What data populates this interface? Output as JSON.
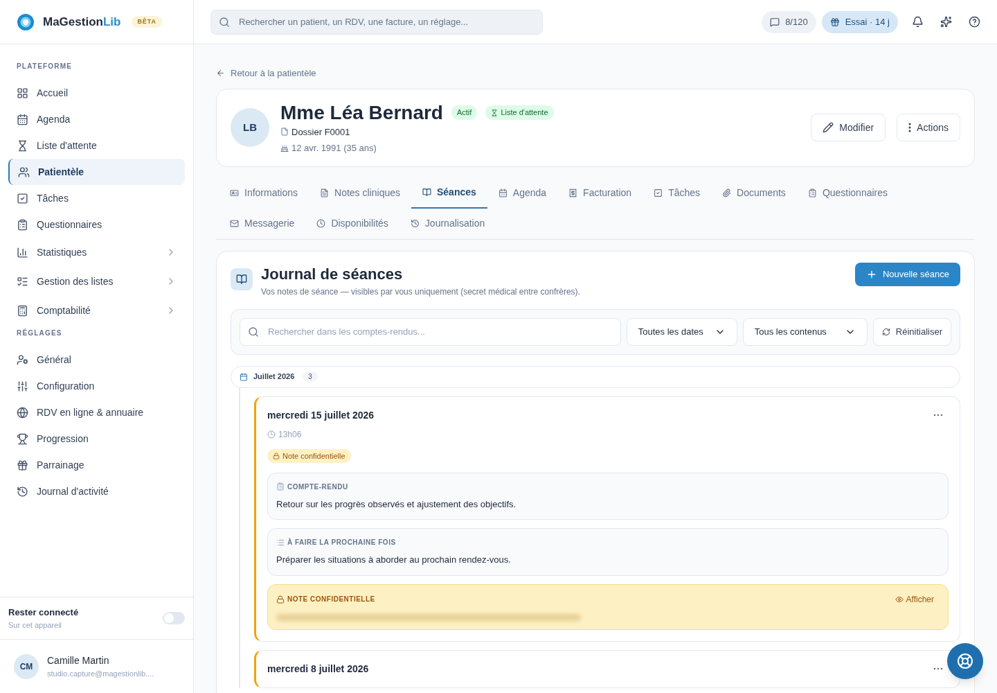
{
  "brand": {
    "name": "MaGestion",
    "name_accent": "Lib",
    "badge": "BÊTA"
  },
  "sidebar": {
    "sections": [
      {
        "title": "PLATEFORME",
        "items": [
          {
            "label": "Accueil",
            "selected": false,
            "submenu": false
          },
          {
            "label": "Agenda",
            "selected": false,
            "submenu": false
          },
          {
            "label": "Liste d'attente",
            "selected": false,
            "submenu": false
          },
          {
            "label": "Patientèle",
            "selected": true,
            "submenu": false
          },
          {
            "label": "Tâches",
            "selected": false,
            "submenu": false
          },
          {
            "label": "Questionnaires",
            "selected": false,
            "submenu": false
          },
          {
            "label": "Statistiques",
            "selected": false,
            "submenu": true
          },
          {
            "label": "Gestion des listes",
            "selected": false,
            "submenu": true
          },
          {
            "label": "Comptabilité",
            "selected": false,
            "submenu": true
          }
        ]
      },
      {
        "title": "RÉGLAGES",
        "items": [
          {
            "label": "Général",
            "selected": false,
            "submenu": false
          },
          {
            "label": "Configuration",
            "selected": false,
            "submenu": false
          },
          {
            "label": "RDV en ligne & annuaire",
            "selected": false,
            "submenu": false
          },
          {
            "label": "Progression",
            "selected": false,
            "submenu": false
          },
          {
            "label": "Parrainage",
            "selected": false,
            "submenu": false
          },
          {
            "label": "Journal d'activité",
            "selected": false,
            "submenu": false
          }
        ]
      }
    ],
    "stay_connected": {
      "title": "Rester connecté",
      "subtitle": "Sur cet appareil",
      "on": false
    },
    "user": {
      "initials": "CM",
      "name": "Camille Martin",
      "email": "studio.capture@magestionlib...."
    }
  },
  "topbar": {
    "search_placeholder": "Rechercher un patient, un RDV, une facture, un réglage...",
    "sms": "8/120",
    "trial": "Essai · 14 j"
  },
  "back_link": "Retour à la patientèle",
  "patient": {
    "initials": "LB",
    "name": "Mme Léa Bernard",
    "badges": [
      "Actif",
      "Liste d'attente"
    ],
    "dossier": "Dossier F0001",
    "birth": "12 avr. 1991 (35 ans)",
    "buttons": [
      "Modifier",
      "Actions"
    ]
  },
  "tabs": [
    {
      "label": "Informations",
      "selected": false
    },
    {
      "label": "Notes cliniques",
      "selected": false
    },
    {
      "label": "Séances",
      "selected": true
    },
    {
      "label": "Agenda",
      "selected": false
    },
    {
      "label": "Facturation",
      "selected": false
    },
    {
      "label": "Tâches",
      "selected": false
    },
    {
      "label": "Documents",
      "selected": false
    },
    {
      "label": "Questionnaires",
      "selected": false
    },
    {
      "label": "Messagerie",
      "selected": false
    },
    {
      "label": "Disponibilités",
      "selected": false
    },
    {
      "label": "Journalisation",
      "selected": false
    }
  ],
  "journal": {
    "title": "Journal de séances",
    "subtitle": "Vos notes de séance — visibles par vous uniquement (secret médical entre confrères).",
    "new_button": "Nouvelle séance",
    "filters": {
      "search_placeholder": "Rechercher dans les comptes-rendus...",
      "dates": "Toutes les dates",
      "contents": "Tous les contenus",
      "reset": "Réinitialiser"
    },
    "month": {
      "label": "Juillet 2026",
      "count": "3"
    },
    "sessions": [
      {
        "date": "mercredi 15 juillet 2026",
        "time": "13h06",
        "confidential_badge": "Note confidentielle",
        "blocks": [
          {
            "kind": "report",
            "title": "COMPTE-RENDU",
            "text": "Retour sur les progrès observés et ajustement des objectifs."
          },
          {
            "kind": "todo",
            "title": "À FAIRE LA PROCHAINE FOIS",
            "text": "Préparer les situations à aborder au prochain rendez-vous."
          },
          {
            "kind": "confidential",
            "title": "NOTE CONFIDENTIELLE",
            "action": "Afficher"
          }
        ]
      },
      {
        "date": "mercredi 8 juillet 2026"
      }
    ]
  }
}
